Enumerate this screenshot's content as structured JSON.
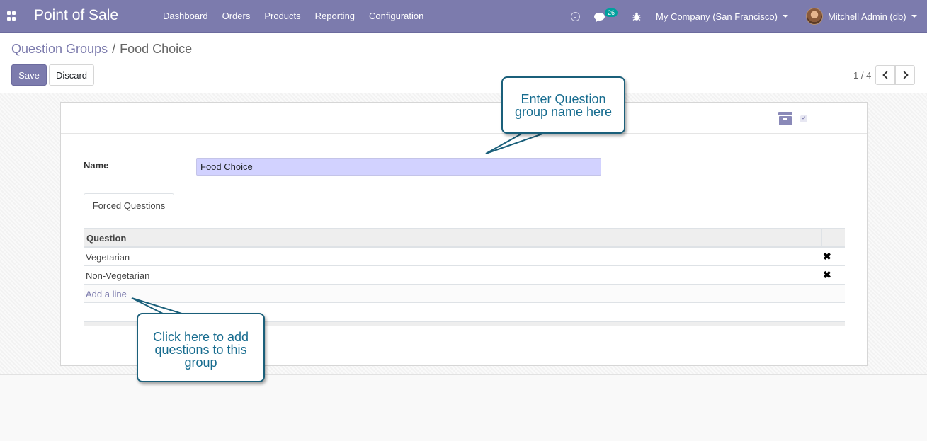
{
  "navbar": {
    "app_title": "Point of Sale",
    "menu": [
      "Dashboard",
      "Orders",
      "Products",
      "Reporting",
      "Configuration"
    ],
    "message_count": "26",
    "company": "My Company (San Francisco)",
    "user": "Mitchell Admin (db)"
  },
  "breadcrumb": {
    "parent": "Question Groups",
    "separator": "/",
    "current": "Food Choice"
  },
  "buttons": {
    "save": "Save",
    "discard": "Discard"
  },
  "pager": {
    "value": "1 / 4"
  },
  "form": {
    "name_label": "Name",
    "name_value": "Food Choice",
    "tab_label": "Forced Questions",
    "table": {
      "column": "Question",
      "rows": [
        "Vegetarian",
        "Non-Vegetarian"
      ],
      "add_line": "Add a line"
    }
  },
  "callouts": {
    "name_line1": "Enter Question",
    "name_line2": "group name here",
    "add_line1": "Click here to add",
    "add_line2": "questions to this",
    "add_line3": "group"
  },
  "icons": {
    "apps": "apps-grid-icon",
    "activity": "clock-icon",
    "messages": "chat-icon",
    "debug": "bug-icon",
    "archive": "archive-icon",
    "delete": "close-icon"
  },
  "colors": {
    "brand": "#7c7bad",
    "callout_text": "#176c8f",
    "field_bg": "#d2d2ff"
  }
}
